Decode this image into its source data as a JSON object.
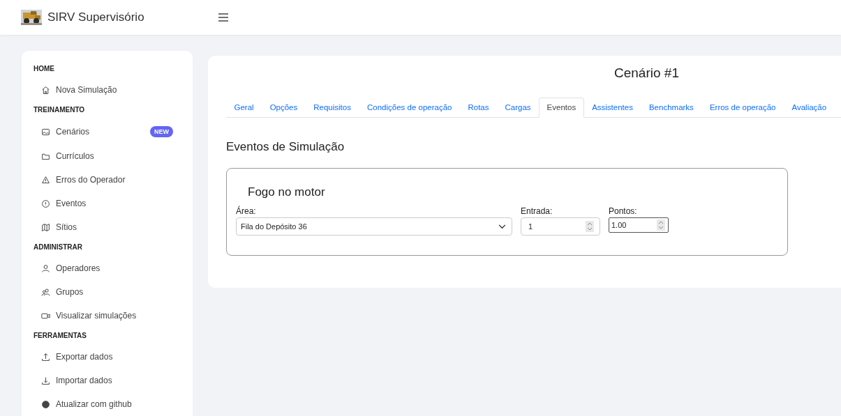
{
  "header": {
    "title": "SIRV Supervisório"
  },
  "sidebar": {
    "sections": [
      {
        "heading": "HOME",
        "items": [
          {
            "label": "Nova Simulação"
          }
        ]
      },
      {
        "heading": "TREINAMENTO",
        "items": [
          {
            "label": "Cenários",
            "badge": "NEW"
          },
          {
            "label": "Currículos"
          },
          {
            "label": "Erros do Operador"
          },
          {
            "label": "Eventos"
          },
          {
            "label": "Sítios"
          }
        ]
      },
      {
        "heading": "ADMINISTRAR",
        "items": [
          {
            "label": "Operadores"
          },
          {
            "label": "Grupos"
          },
          {
            "label": "Visualizar simulações"
          }
        ]
      },
      {
        "heading": "FERRAMENTAS",
        "items": [
          {
            "label": "Exportar dados"
          },
          {
            "label": "Importar dados"
          },
          {
            "label": "Atualizar com github"
          }
        ]
      }
    ]
  },
  "main": {
    "title": "Cenário #1",
    "tabs": [
      {
        "label": "Geral",
        "selected": false
      },
      {
        "label": "Opções",
        "selected": false
      },
      {
        "label": "Requisitos",
        "selected": false
      },
      {
        "label": "Condições de operação",
        "selected": false
      },
      {
        "label": "Rotas",
        "selected": false
      },
      {
        "label": "Cargas",
        "selected": false
      },
      {
        "label": "Eventos",
        "selected": true
      },
      {
        "label": "Assistentes",
        "selected": false
      },
      {
        "label": "Benchmarks",
        "selected": false
      },
      {
        "label": "Erros de operação",
        "selected": false
      },
      {
        "label": "Avaliação",
        "selected": false
      }
    ],
    "section_title": "Eventos de Simulação",
    "event": {
      "title": "Fogo no motor",
      "area_label": "Área:",
      "area_value": "Fila do Depósito 36",
      "entrada_label": "Entrada:",
      "entrada_value": "1",
      "pontos_label": "Pontos:",
      "pontos_value": "1.00"
    }
  }
}
